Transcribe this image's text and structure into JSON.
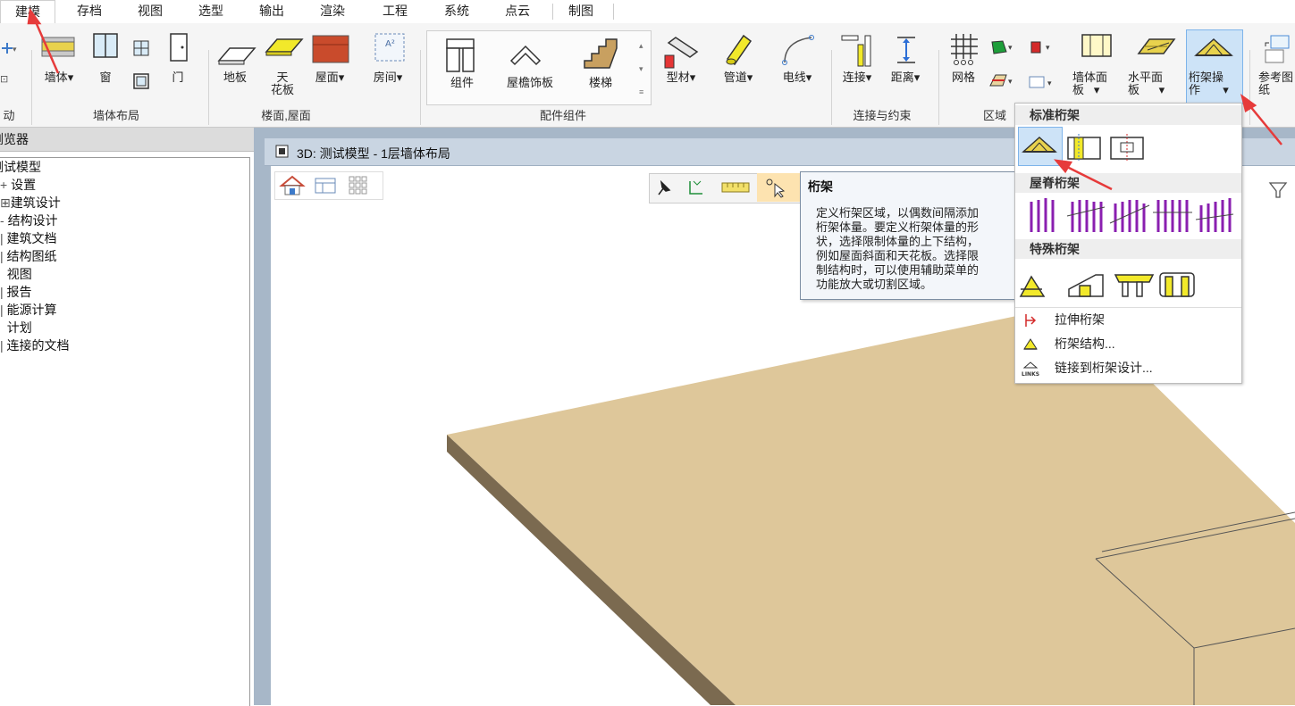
{
  "tabs": [
    "建模",
    "存档",
    "视图",
    "选型",
    "输出",
    "渲染",
    "工程",
    "系统",
    "点云",
    "制图"
  ],
  "ribbon": {
    "left_clip": {
      "item1": "动"
    },
    "wall": {
      "wall": "墙体",
      "window": "窗",
      "door": "门",
      "group": "墙体布局"
    },
    "floor": {
      "slab": "地板",
      "ceiling_l1": "天",
      "ceiling_l2": "花板",
      "roof": "屋面",
      "room": "房间",
      "group": "楼面,屋面"
    },
    "components": {
      "component": "组件",
      "fascia": "屋檐饰板",
      "stairs": "楼梯",
      "profile": "型材",
      "pipe": "管道",
      "wire": "电线",
      "group": "配件组件"
    },
    "connect": {
      "connect": "连接",
      "distance": "距离",
      "group": "连接与约束"
    },
    "region": {
      "grid": "网格",
      "group": "区域"
    },
    "truss": {
      "wallface_l1": "墙体面",
      "wallface_l2": "板",
      "horizontal_l1": "水平面",
      "horizontal_l2": "板",
      "truss_l1": "桁架操",
      "truss_l2": "作",
      "ref_l1": "参考图",
      "ref_l2": "纸"
    }
  },
  "browser": {
    "title": "浏览器",
    "items": [
      "测试模型",
      "设置",
      "建筑设计",
      "结构设计",
      "建筑文档",
      "结构图纸",
      "视图",
      "报告",
      "能源计算",
      "计划",
      "连接的文档"
    ]
  },
  "view": {
    "title": "3D: 测试模型 - 1层墙体布局"
  },
  "truss_menu": {
    "standard_header": "标准桁架",
    "ridge_header": "屋脊桁架",
    "special_header": "特殊桁架",
    "items": [
      "拉伸桁架",
      "桁架结构...",
      "链接到桁架设计..."
    ]
  },
  "tooltip": {
    "title": "桁架",
    "lines": [
      "定义桁架区域，以偶数间隔添加",
      "桁架体量。要定义桁架体量的形",
      "状，选择限制体量的上下结构，",
      "例如屋面斜面和天花板。选择限",
      "制结构时，可以使用辅助菜单的",
      "功能放大或切割区域。"
    ]
  },
  "colors": {
    "accent_blue": "#cde3f7",
    "annotation_red": "#e63b3b",
    "slab_top": "#dec79a",
    "slab_side": "#7b6a50",
    "magenta": "#8a1fb0"
  }
}
